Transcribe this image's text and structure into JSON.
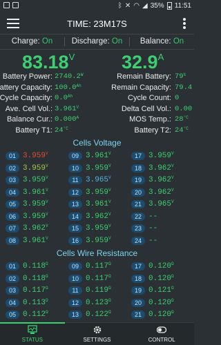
{
  "status_bar": {
    "battery_pct": "35%",
    "time": "11:51"
  },
  "appbar": {
    "title": "TIME: 23M17S"
  },
  "modes": [
    {
      "label": "Charge:",
      "value": "On"
    },
    {
      "label": "Discharge:",
      "value": "On"
    },
    {
      "label": "Balance:",
      "value": "On"
    }
  ],
  "voltage": {
    "value": "83.18",
    "unit": "V"
  },
  "current": {
    "value": "32.9",
    "unit": "A"
  },
  "stats": [
    {
      "lk": "Battery Power:",
      "lv": "2740.2",
      "lu": "W",
      "rk": "Remain Battery:",
      "rv": "79",
      "ru": "%"
    },
    {
      "lk": "Battery Capacity:",
      "lv": "100.0",
      "lu": "Ah",
      "rk": "Remain Capacity:",
      "rv": "79.4",
      "ru": ""
    },
    {
      "lk": "Cycle Capacity:",
      "lv": "0.0",
      "lu": "Ah",
      "rk": "Cycle Count:",
      "rv": "0",
      "ru": ""
    },
    {
      "lk": "Ave. Cell Vol.:",
      "lv": "3.961",
      "lu": "V",
      "rk": "Delta Cell Vol.:",
      "rv": "0.00",
      "ru": ""
    },
    {
      "lk": "Balance Cur.:",
      "lv": "0.000",
      "lu": "A",
      "rk": "MOS Temp.:",
      "rv": "28",
      "ru": "°C"
    },
    {
      "lk": "Battery T1:",
      "lv": "24",
      "lu": "°C",
      "rk": "Battery T2:",
      "rv": "24",
      "ru": "°C"
    }
  ],
  "cells_voltage": {
    "title": "Cells Voltage",
    "cells": [
      {
        "id": "01",
        "v": "3.959",
        "u": "V",
        "c": "hi"
      },
      {
        "id": "02",
        "v": "3.959",
        "u": "V",
        "c": "mid"
      },
      {
        "id": "03",
        "v": "3.959",
        "u": "V",
        "c": ""
      },
      {
        "id": "04",
        "v": "3.961",
        "u": "V",
        "c": ""
      },
      {
        "id": "05",
        "v": "3.959",
        "u": "V",
        "c": ""
      },
      {
        "id": "06",
        "v": "3.959",
        "u": "V",
        "c": ""
      },
      {
        "id": "07",
        "v": "3.962",
        "u": "V",
        "c": ""
      },
      {
        "id": "08",
        "v": "3.961",
        "u": "V",
        "c": ""
      },
      {
        "id": "09",
        "v": "3.961",
        "u": "V",
        "c": ""
      },
      {
        "id": "10",
        "v": "3.959",
        "u": "V",
        "c": ""
      },
      {
        "id": "11",
        "v": "3.965",
        "u": "V",
        "c": "lo"
      },
      {
        "id": "12",
        "v": "3.959",
        "u": "V",
        "c": ""
      },
      {
        "id": "13",
        "v": "3.961",
        "u": "V",
        "c": ""
      },
      {
        "id": "14",
        "v": "3.962",
        "u": "V",
        "c": ""
      },
      {
        "id": "15",
        "v": "3.959",
        "u": "V",
        "c": ""
      },
      {
        "id": "16",
        "v": "3.959",
        "u": "V",
        "c": ""
      },
      {
        "id": "17",
        "v": "3.959",
        "u": "V",
        "c": ""
      },
      {
        "id": "18",
        "v": "3.962",
        "u": "V",
        "c": ""
      },
      {
        "id": "19",
        "v": "3.962",
        "u": "V",
        "c": ""
      },
      {
        "id": "20",
        "v": "3.962",
        "u": "V",
        "c": ""
      },
      {
        "id": "21",
        "v": "3.965",
        "u": "V",
        "c": ""
      },
      {
        "id": "22",
        "v": "--",
        "u": "",
        "c": "dash"
      },
      {
        "id": "23",
        "v": "--",
        "u": "",
        "c": "dash"
      },
      {
        "id": "24",
        "v": "--",
        "u": "",
        "c": "dash"
      }
    ]
  },
  "cells_resistance": {
    "title": "Cells Wire Resistance",
    "cells": [
      {
        "id": "01",
        "v": "0.118",
        "u": "Ω",
        "c": ""
      },
      {
        "id": "02",
        "v": "0.118",
        "u": "Ω",
        "c": ""
      },
      {
        "id": "03",
        "v": "0.117",
        "u": "Ω",
        "c": ""
      },
      {
        "id": "04",
        "v": "0.113",
        "u": "Ω",
        "c": ""
      },
      {
        "id": "05",
        "v": "0.112",
        "u": "Ω",
        "c": ""
      },
      {
        "id": "09",
        "v": "0.117",
        "u": "Ω",
        "c": ""
      },
      {
        "id": "10",
        "v": "0.117",
        "u": "Ω",
        "c": ""
      },
      {
        "id": "11",
        "v": "0.119",
        "u": "Ω",
        "c": ""
      },
      {
        "id": "12",
        "v": "0.123",
        "u": "Ω",
        "c": ""
      },
      {
        "id": "13",
        "v": "0.122",
        "u": "Ω",
        "c": ""
      },
      {
        "id": "17",
        "v": "0.120",
        "u": "Ω",
        "c": ""
      },
      {
        "id": "18",
        "v": "0.120",
        "u": "Ω",
        "c": ""
      },
      {
        "id": "19",
        "v": "0.121",
        "u": "Ω",
        "c": ""
      },
      {
        "id": "20",
        "v": "0.120",
        "u": "Ω",
        "c": ""
      },
      {
        "id": "21",
        "v": "0.120",
        "u": "Ω",
        "c": ""
      }
    ]
  },
  "nav": [
    {
      "label": "STATUS",
      "icon": "status-icon",
      "active": true
    },
    {
      "label": "SETTINGS",
      "icon": "gear-icon",
      "active": false
    },
    {
      "label": "CONTROL",
      "icon": "toggle-icon",
      "active": false
    }
  ]
}
